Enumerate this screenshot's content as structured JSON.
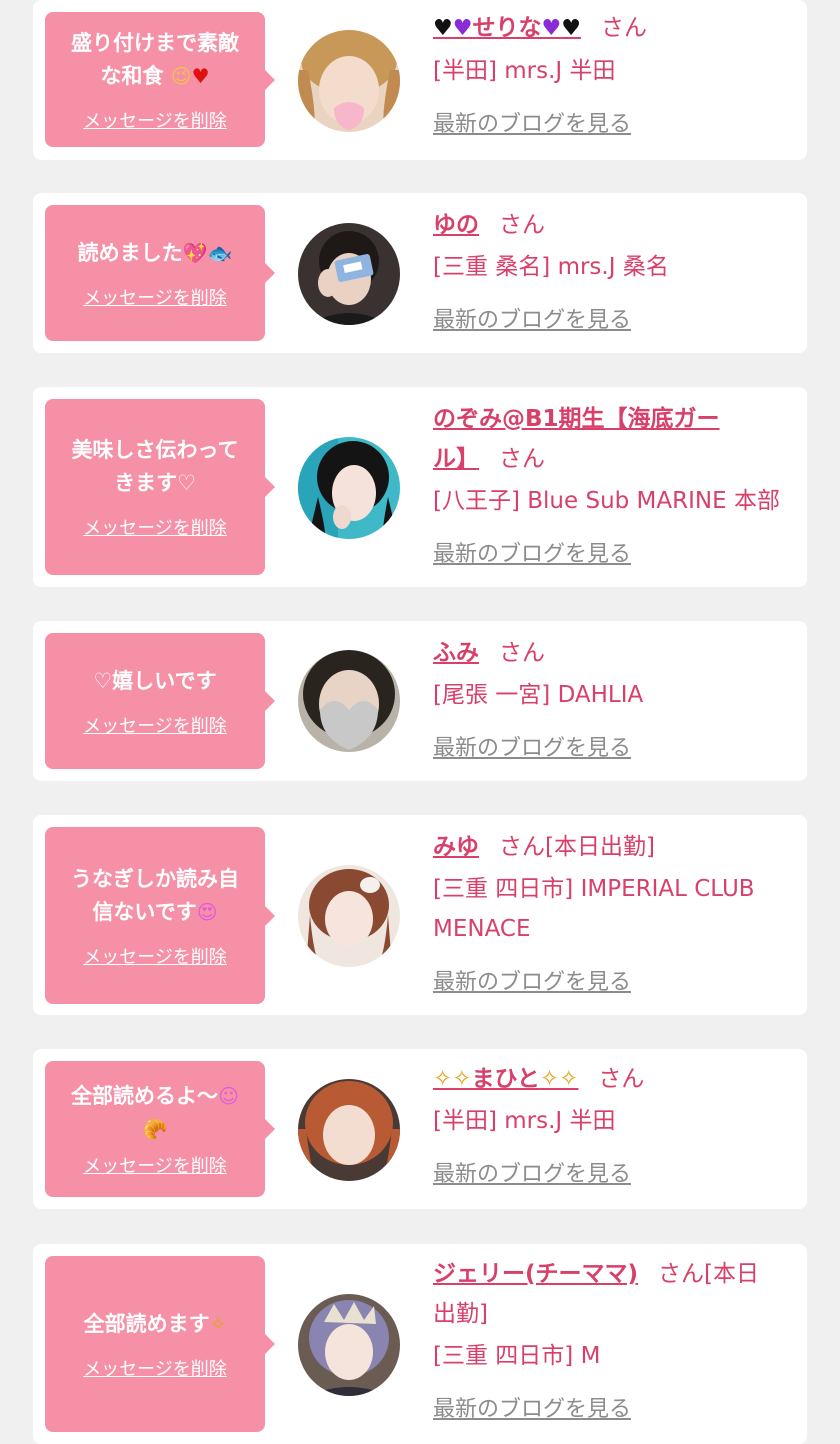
{
  "delete_label": "メッセージを削除",
  "blog_label": "最新のブログを見る",
  "san_label": "さん",
  "colors": {
    "bubble": "#f590a6",
    "accent": "#d8406a",
    "link_gray": "#8c8c8c",
    "background": "#f0f0f0"
  },
  "entries": [
    {
      "message_l1": "盛り付けまで素敵",
      "message_l2": "な和食",
      "message_icons": [
        "wink-face-icon",
        "red-heart-icon"
      ],
      "name": "せりな",
      "name_icons": [
        "black-heart-icon",
        "purple-heart-icon"
      ],
      "status": "",
      "area": "[半田] mrs.J 半田"
    },
    {
      "message_l1": "読めました",
      "message_l2": "",
      "message_icons": [
        "sparkling-heart-icon",
        "fish-icon"
      ],
      "name": "ゆの",
      "status": "",
      "area": "[三重 桑名] mrs.J 桑名"
    },
    {
      "message_l1": "美味しさ伝わって",
      "message_l2": "きます♡",
      "message_icons": [],
      "name_l1": "のぞみ@B1期生【海底ガー",
      "name_l2": "ル】",
      "status": "",
      "area": "[八王子] Blue Sub MARINE 本部"
    },
    {
      "message_l1": "♡嬉しいです",
      "message_l2": "",
      "message_icons": [],
      "name": "ふみ",
      "status": "",
      "area": "[尾張 一宮] DAHLIA"
    },
    {
      "message_l1": "うなぎしか読み自",
      "message_l2": "信ないです",
      "message_icons": [
        "heart-eyes-face-icon"
      ],
      "name": "みゆ",
      "status": "[本日出勤]",
      "area_l1": "[三重 四日市] IMPERIAL CLUB",
      "area_l2": "MENACE"
    },
    {
      "message_l1": "全部読めるよ〜",
      "message_l2": "",
      "message_icons": [
        "smiling-face-icon",
        "bread-icon"
      ],
      "name": "まひと",
      "name_icons": [
        "sparkles-icon"
      ],
      "status": "",
      "area": "[半田] mrs.J 半田"
    },
    {
      "message_l1": "全部読めます",
      "message_l2": "",
      "message_icons": [
        "sparkles-icon"
      ],
      "name": "ジェリー(チーママ)",
      "status_l1": "[本日",
      "status_l2": "出勤]",
      "area": "[三重 四日市] M"
    }
  ]
}
